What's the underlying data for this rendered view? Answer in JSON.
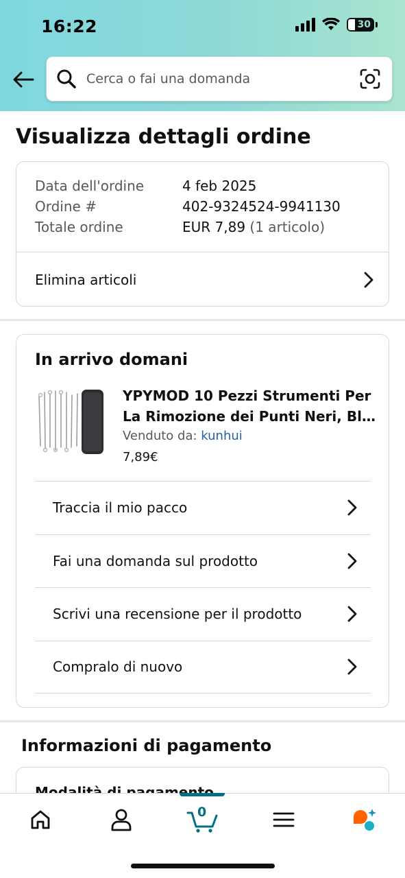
{
  "status_bar": {
    "time": "16:22",
    "battery": "30"
  },
  "search": {
    "placeholder": "Cerca o fai una domanda"
  },
  "page": {
    "title": "Visualizza dettagli ordine"
  },
  "order_summary": {
    "rows": [
      {
        "label": "Data dell'ordine",
        "value": "4 feb 2025",
        "extra": ""
      },
      {
        "label": "Ordine #",
        "value": "402-9324524-9941130",
        "extra": ""
      },
      {
        "label": "Totale ordine",
        "value": "EUR 7,89",
        "extra": "(1 articolo)"
      }
    ],
    "delete_items_label": "Elimina articoli"
  },
  "delivery": {
    "title": "In arrivo domani",
    "product": {
      "name_line1": "YPYMOD 10 Pezzi Strumenti Per",
      "name_line2": "La Rimozione dei Punti Neri, Bl...",
      "sold_by_label": "Venduto da:",
      "seller": "kunhui",
      "price": "7,89€"
    },
    "actions": [
      "Traccia il mio pacco",
      "Fai una domanda sul prodotto",
      "Scrivi una recensione per il prodotto",
      "Compralo di nuovo"
    ]
  },
  "payment": {
    "title": "Informazioni di pagamento",
    "method_label": "Modalità di pagamento"
  },
  "bottom_nav": {
    "items": [
      "home-icon",
      "account-icon",
      "cart-icon",
      "menu-icon",
      "rufus-icon"
    ],
    "cart_count": "0",
    "accent": "#007185"
  },
  "colors": {
    "header_start": "#7fd8df",
    "header_end": "#a9e4cf",
    "link": "#2162a1",
    "accent": "#007185",
    "rufus_orange": "#ff6200",
    "rufus_teal": "#1ab2c0"
  }
}
